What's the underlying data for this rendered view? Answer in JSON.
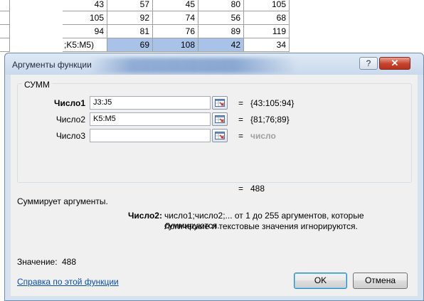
{
  "sheet": {
    "rows": [
      {
        "cells": [
          "43",
          "57",
          "45",
          "80",
          "105"
        ]
      },
      {
        "cells": [
          "105",
          "92",
          "74",
          "56",
          "68"
        ]
      },
      {
        "cells": [
          "94",
          "81",
          "76",
          "89",
          "119"
        ]
      },
      {
        "formula": ";K5:M5)",
        "cells": [
          "69",
          "108",
          "42",
          "34"
        ]
      }
    ]
  },
  "dialog": {
    "title": "Аргументы функции",
    "help_label": "?",
    "close_label": "✕",
    "function_name": "СУММ",
    "args": [
      {
        "label": "Число1",
        "value": "J3:J5",
        "result": "{43:105:94}"
      },
      {
        "label": "Число2",
        "value": "K5:M5",
        "result": "{81;76;89}"
      },
      {
        "label": "Число3",
        "value": "",
        "result": "число"
      }
    ],
    "equals": "=",
    "total_result": "488",
    "description": "Суммирует аргументы.",
    "arg_help_name": "Число2:",
    "arg_help_line1": "число1;число2;... от 1 до 255 аргументов, которые суммируются.",
    "arg_help_line2": "Логические и текстовые значения игнорируются.",
    "value_label": "Значение:",
    "value": "488",
    "help_link": "Справка по этой функции",
    "ok_label": "OK",
    "cancel_label": "Отмена",
    "collapse_icon": "range-select-icon"
  }
}
